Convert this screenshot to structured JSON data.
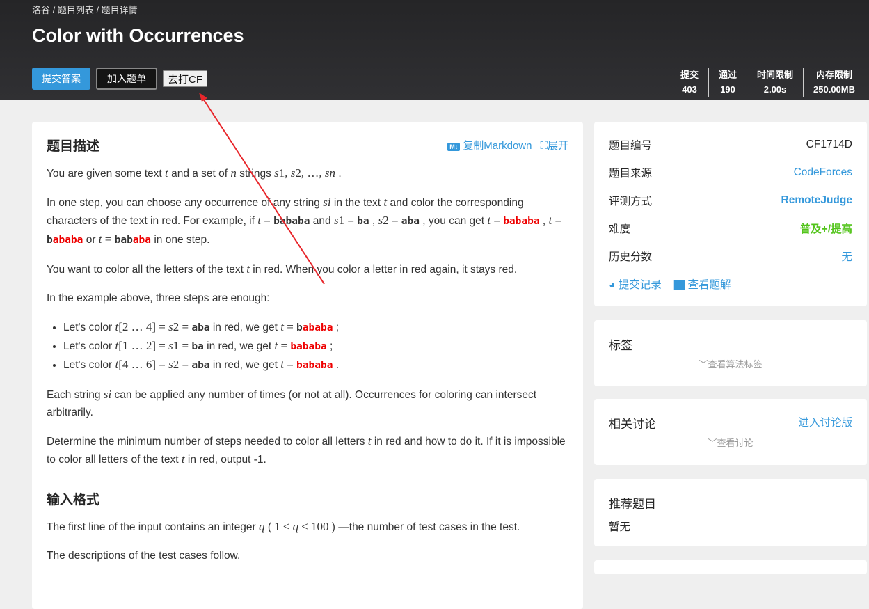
{
  "breadcrumb": "洛谷 / 题目列表 / 题目详情",
  "title": "Color with Occurrences",
  "buttons": {
    "submit": "提交答案",
    "add_list": "加入题单",
    "go_cf": "去打CF"
  },
  "stats": [
    {
      "label": "提交",
      "value": "403"
    },
    {
      "label": "通过",
      "value": "190"
    },
    {
      "label": "时间限制",
      "value": "2.00s"
    },
    {
      "label": "内存限制",
      "value": "250.00MB"
    }
  ],
  "description": {
    "heading": "题目描述",
    "md_icon": "M↓",
    "copy_markdown": "复制Markdown",
    "expand": "展开",
    "paragraphs": [
      [
        [
          "You are given some text ",
          ""
        ],
        [
          "t",
          "m"
        ],
        [
          " and a set of ",
          ""
        ],
        [
          "n",
          "m"
        ],
        [
          " strings ",
          ""
        ],
        [
          "s",
          "m"
        ],
        [
          "1, ",
          "mn"
        ],
        [
          "s",
          "m"
        ],
        [
          "2, …, ",
          "mn"
        ],
        [
          "s",
          "m"
        ],
        [
          "n",
          "m"
        ],
        [
          " .",
          ""
        ]
      ],
      [
        [
          "In one step, you can choose any occurrence of any string ",
          ""
        ],
        [
          "s",
          "m"
        ],
        [
          "i",
          "m"
        ],
        [
          " in the text ",
          ""
        ],
        [
          "t",
          "m"
        ],
        [
          " and color the corresponding characters of the text in red. For example, if ",
          ""
        ],
        [
          "t",
          "m"
        ],
        [
          " = ",
          "mn"
        ],
        [
          "bababa",
          "b"
        ],
        [
          " and ",
          ""
        ],
        [
          "s",
          "m"
        ],
        [
          "1",
          "mn"
        ],
        [
          " = ",
          "mn"
        ],
        [
          "ba",
          "b"
        ],
        [
          " , ",
          ""
        ],
        [
          "s",
          "m"
        ],
        [
          "2",
          "mn"
        ],
        [
          " = ",
          "mn"
        ],
        [
          "aba",
          "b"
        ],
        [
          " , you can get ",
          ""
        ],
        [
          "t",
          "m"
        ],
        [
          " = ",
          "mn"
        ],
        [
          "bababa",
          "r"
        ],
        [
          " , ",
          ""
        ],
        [
          "t",
          "m"
        ],
        [
          " = ",
          "mn"
        ],
        [
          "b",
          "b"
        ],
        [
          "ababa",
          "r"
        ],
        [
          " or ",
          ""
        ],
        [
          "t",
          "m"
        ],
        [
          " = ",
          "mn"
        ],
        [
          "bab",
          "b"
        ],
        [
          "aba",
          "r"
        ],
        [
          " in one step.",
          ""
        ]
      ],
      [
        [
          "You want to color all the letters of the text ",
          ""
        ],
        [
          "t",
          "m"
        ],
        [
          " in red. When you color a letter in red again, it stays red.",
          ""
        ]
      ],
      [
        [
          "In the example above, three steps are enough:",
          ""
        ]
      ]
    ],
    "list": [
      [
        [
          "Let's color ",
          ""
        ],
        [
          "t",
          "m"
        ],
        [
          "[2 … 4] = ",
          "mn"
        ],
        [
          "s",
          "m"
        ],
        [
          "2",
          "mn"
        ],
        [
          " = ",
          "mn"
        ],
        [
          "aba",
          "b"
        ],
        [
          " in red, we get ",
          ""
        ],
        [
          "t",
          "m"
        ],
        [
          " = ",
          "mn"
        ],
        [
          "b",
          "b"
        ],
        [
          "ababa",
          "r"
        ],
        [
          " ;",
          ""
        ]
      ],
      [
        [
          "Let's color ",
          ""
        ],
        [
          "t",
          "m"
        ],
        [
          "[1 … 2] = ",
          "mn"
        ],
        [
          "s",
          "m"
        ],
        [
          "1",
          "mn"
        ],
        [
          " = ",
          "mn"
        ],
        [
          "ba",
          "b"
        ],
        [
          " in red, we get ",
          ""
        ],
        [
          "t",
          "m"
        ],
        [
          " = ",
          "mn"
        ],
        [
          "bababa",
          "r"
        ],
        [
          " ;",
          ""
        ]
      ],
      [
        [
          "Let's color ",
          ""
        ],
        [
          "t",
          "m"
        ],
        [
          "[4 … 6] = ",
          "mn"
        ],
        [
          "s",
          "m"
        ],
        [
          "2",
          "mn"
        ],
        [
          " = ",
          "mn"
        ],
        [
          "aba",
          "b"
        ],
        [
          " in red, we get ",
          ""
        ],
        [
          "t",
          "m"
        ],
        [
          " = ",
          "mn"
        ],
        [
          "bababa",
          "r"
        ],
        [
          " .",
          ""
        ]
      ]
    ],
    "paragraphs2": [
      [
        [
          "Each string ",
          ""
        ],
        [
          "s",
          "m"
        ],
        [
          "i",
          "m"
        ],
        [
          " can be applied any number of times (or not at all). Occurrences for coloring can intersect arbitrarily.",
          ""
        ]
      ],
      [
        [
          "Determine the minimum number of steps needed to color all letters ",
          ""
        ],
        [
          "t",
          "m"
        ],
        [
          " in red and how to do it. If it is impossible to color all letters of the text ",
          ""
        ],
        [
          "t",
          "m"
        ],
        [
          " in red, output -1.",
          ""
        ]
      ]
    ]
  },
  "input_format": {
    "heading": "输入格式",
    "paragraphs": [
      [
        [
          "The first line of the input contains an integer ",
          ""
        ],
        [
          "q",
          "m"
        ],
        [
          " ( ",
          ""
        ],
        [
          "1 ≤ ",
          "mn"
        ],
        [
          "q",
          "m"
        ],
        [
          " ≤ 100",
          "mn"
        ],
        [
          " ) —the number of test cases in the test.",
          ""
        ]
      ],
      [
        [
          "The descriptions of the test cases follow.",
          ""
        ]
      ]
    ]
  },
  "info": {
    "rows": [
      {
        "label": "题目编号",
        "value": "CF1714D",
        "style": ""
      },
      {
        "label": "题目来源",
        "value": "CodeForces",
        "style": "blue"
      },
      {
        "label": "评测方式",
        "value": "RemoteJudge",
        "style": "blue bold"
      },
      {
        "label": "难度",
        "value": "普及+/提高",
        "style": "green"
      },
      {
        "label": "历史分数",
        "value": "无",
        "style": "blue"
      }
    ],
    "submissions": "提交记录",
    "solutions": "查看题解"
  },
  "tags": {
    "heading": "标签",
    "toggle": "查看算法标签"
  },
  "discussion": {
    "heading": "相关讨论",
    "link": "进入讨论版",
    "toggle": "查看讨论"
  },
  "recommend": {
    "heading": "推荐题目",
    "value": "暂无"
  }
}
